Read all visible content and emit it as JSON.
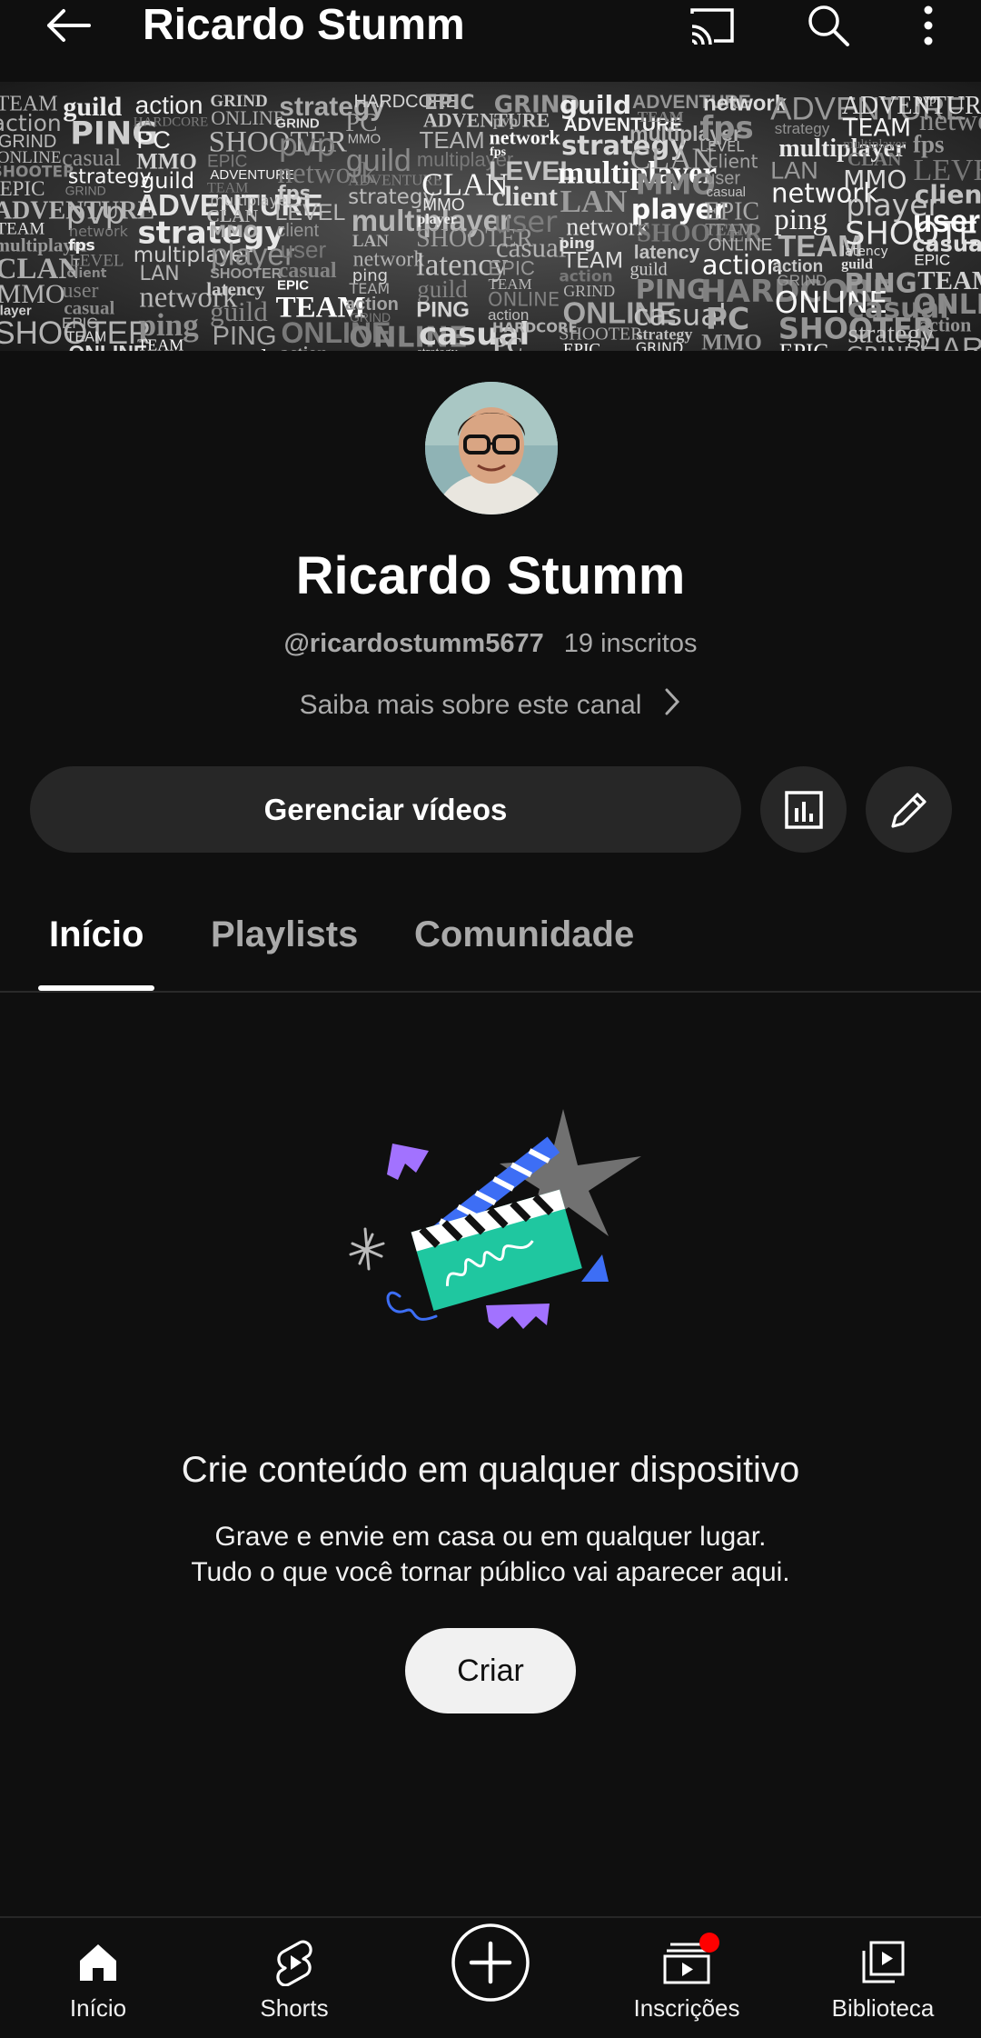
{
  "header": {
    "title": "Ricardo Stumm",
    "icons": [
      "back-arrow-icon",
      "cast-icon",
      "search-icon",
      "more-vert-icon"
    ]
  },
  "banner": {
    "words": [
      "TEAM",
      "action",
      "GRIND",
      "ONLINE",
      "SHOOTER",
      "EPIC",
      "ADVENTURE",
      "TEAM",
      "multiplayer",
      "CLAN",
      "MMO",
      "player",
      "SHOOTER",
      "latency",
      "guild",
      "PING",
      "casual",
      "strategy",
      "GRIND",
      "pvp",
      "network",
      "fps",
      "LEVEL",
      "client",
      "user",
      "casual",
      "EPIC",
      "TEAM",
      "ONLINE",
      "action",
      "HARDCORE",
      "PC",
      "MMO",
      "guild",
      "ADVENTURE",
      "strategy",
      "multiplayer",
      "LAN",
      "network",
      "ping"
    ]
  },
  "channel": {
    "name": "Ricardo Stumm",
    "handle": "@ricardostumm5677",
    "subscribers": "19 inscritos",
    "about": "Saiba mais sobre este canal"
  },
  "actions": {
    "manage_label": "Gerenciar vídeos",
    "analytics_icon": "analytics-icon",
    "edit_icon": "pencil-icon"
  },
  "tabs": [
    {
      "label": "Início",
      "active": true
    },
    {
      "label": "Playlists",
      "active": false
    },
    {
      "label": "Comunidade",
      "active": false
    }
  ],
  "empty_state": {
    "title": "Crie conteúdo em qualquer dispositivo",
    "line1": "Grave e envie em casa ou em qualquer lugar.",
    "line2": "Tudo o que você tornar público vai aparecer aqui.",
    "button": "Criar"
  },
  "bottom_nav": [
    {
      "label": "Início",
      "icon": "home-icon"
    },
    {
      "label": "Shorts",
      "icon": "shorts-icon"
    },
    {
      "label": "",
      "icon": "create-plus-icon"
    },
    {
      "label": "Inscrições",
      "icon": "subscriptions-icon",
      "badge": true
    },
    {
      "label": "Biblioteca",
      "icon": "library-icon"
    }
  ],
  "colors": {
    "background": "#0f0f0f",
    "surface": "#272727",
    "text_secondary": "#aaaaaa",
    "badge": "#ff0000"
  }
}
